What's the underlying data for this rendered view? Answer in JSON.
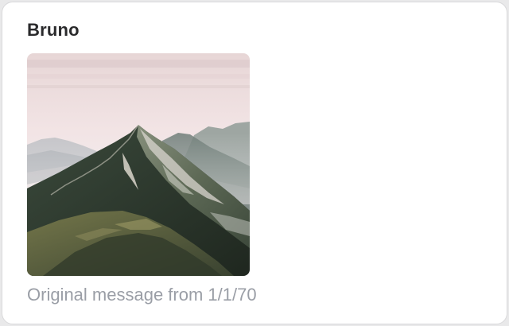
{
  "message": {
    "sender_name": "Bruno",
    "footer_text": "Original message from 1/1/70"
  },
  "attachment": {
    "type": "image",
    "subject": "mountain-peak-photo"
  },
  "colors": {
    "page_bg": "#e9e9ea",
    "card_bg": "#ffffff",
    "sender_text": "#2a2a2c",
    "caption_text": "#9a9ea6"
  }
}
